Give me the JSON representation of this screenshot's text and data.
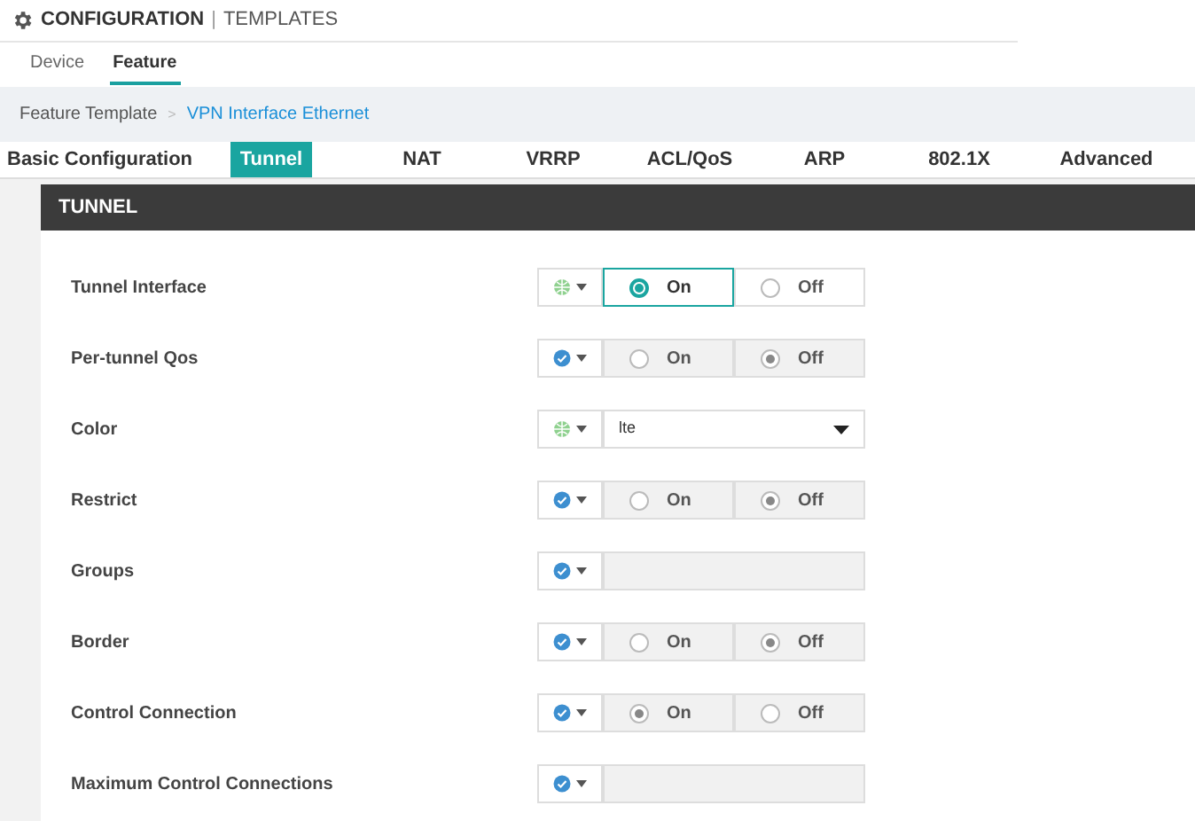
{
  "header": {
    "title": "CONFIGURATION",
    "divider": "|",
    "subtitle": "TEMPLATES"
  },
  "view_tabs": [
    {
      "label": "Device",
      "selected": false
    },
    {
      "label": "Feature",
      "selected": true
    }
  ],
  "breadcrumb": {
    "parent": "Feature Template",
    "separator": ">",
    "current": "VPN Interface Ethernet"
  },
  "section_tabs": [
    {
      "label": "Basic Configuration",
      "selected": false
    },
    {
      "label": "Tunnel",
      "selected": true
    },
    {
      "label": "NAT",
      "selected": false
    },
    {
      "label": "VRRP",
      "selected": false
    },
    {
      "label": "ACL/QoS",
      "selected": false
    },
    {
      "label": "ARP",
      "selected": false
    },
    {
      "label": "802.1X",
      "selected": false
    },
    {
      "label": "Advanced",
      "selected": false
    }
  ],
  "panel": {
    "title": "TUNNEL"
  },
  "fields": [
    {
      "label": "Tunnel Interface",
      "kind": "radio",
      "is_default": false,
      "options": [
        {
          "label": "On",
          "selected": true
        },
        {
          "label": "Off",
          "selected": false
        }
      ]
    },
    {
      "label": "Per-tunnel Qos",
      "kind": "radio",
      "is_default": true,
      "options": [
        {
          "label": "On",
          "selected": false
        },
        {
          "label": "Off",
          "selected": true
        }
      ]
    },
    {
      "label": "Color",
      "kind": "select",
      "is_default": false,
      "value": "lte"
    },
    {
      "label": "Restrict",
      "kind": "radio",
      "is_default": true,
      "options": [
        {
          "label": "On",
          "selected": false
        },
        {
          "label": "Off",
          "selected": true
        }
      ]
    },
    {
      "label": "Groups",
      "kind": "text",
      "is_default": true
    },
    {
      "label": "Border",
      "kind": "radio",
      "is_default": true,
      "options": [
        {
          "label": "On",
          "selected": false
        },
        {
          "label": "Off",
          "selected": true
        }
      ]
    },
    {
      "label": "Control Connection",
      "kind": "radio",
      "is_default": true,
      "options": [
        {
          "label": "On",
          "selected": true
        },
        {
          "label": "Off",
          "selected": false
        }
      ]
    },
    {
      "label": "Maximum Control Connections",
      "kind": "text",
      "is_default": true
    }
  ]
}
